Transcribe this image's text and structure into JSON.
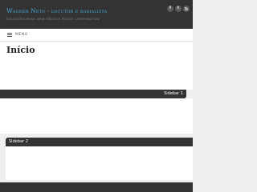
{
  "header": {
    "title": "Wagner Neto - locutor e radialista",
    "tagline": "SOLUÇÕES PARA WEB RÁDIO E RÁDIO CORPORATIVA",
    "social": [
      {
        "icon": "facebook-icon",
        "glyph": "f"
      },
      {
        "icon": "twitter-icon",
        "glyph": "t"
      },
      {
        "icon": "rss-icon",
        "glyph": ")"
      }
    ]
  },
  "nav": {
    "menu_label": "MENU",
    "menu_icon": "hamburger-icon"
  },
  "main": {
    "page_title": "Início"
  },
  "sidebars": {
    "sidebar1_label": "Sidebar 1",
    "sidebar2_label": "Sidebar 2"
  },
  "colors": {
    "header_bg": "#333333",
    "title_accent": "#4aa7d9",
    "page_bg": "#efefef"
  }
}
